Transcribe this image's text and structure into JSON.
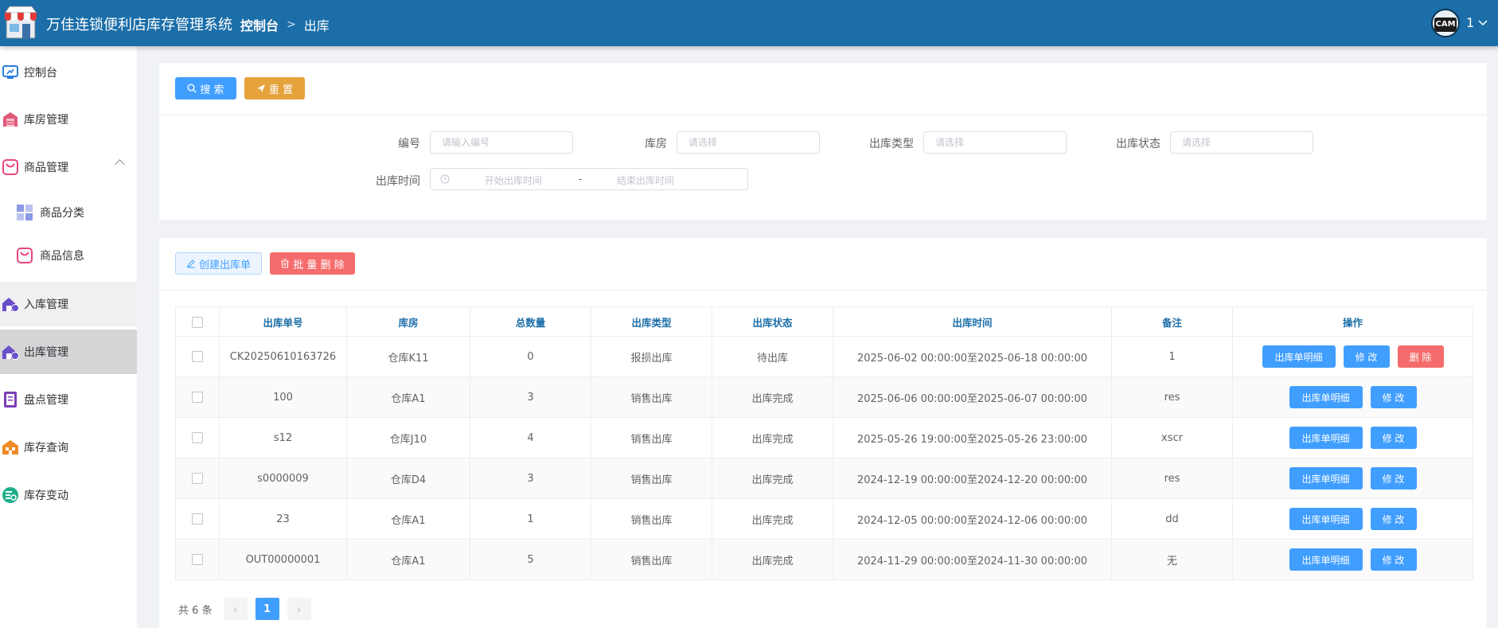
{
  "header": {
    "app_title": "万佳连锁便利店库存管理系统",
    "breadcrumb_home": "控制台",
    "breadcrumb_current": "出库",
    "avatar_text": "CAM",
    "user_name": "1"
  },
  "sidebar": {
    "items": [
      {
        "label": "控制台",
        "icon": "dashboard-icon"
      },
      {
        "label": "库房管理",
        "icon": "warehouse-icon"
      },
      {
        "label": "商品管理",
        "icon": "goods-icon"
      },
      {
        "label": "商品分类",
        "icon": "category-icon"
      },
      {
        "label": "商品信息",
        "icon": "goods-info-icon"
      },
      {
        "label": "入库管理",
        "icon": "inbound-icon"
      },
      {
        "label": "出库管理",
        "icon": "outbound-icon"
      },
      {
        "label": "盘点管理",
        "icon": "inventory-check-icon"
      },
      {
        "label": "库存查询",
        "icon": "stock-query-icon"
      },
      {
        "label": "库存变动",
        "icon": "stock-change-icon"
      }
    ],
    "selected": "出库管理"
  },
  "search": {
    "search_button": "搜 索",
    "reset_button": "重 置",
    "fields": {
      "code": {
        "label": "编号",
        "placeholder": "请输入编号"
      },
      "warehouse": {
        "label": "库房",
        "placeholder": "请选择"
      },
      "type": {
        "label": "出库类型",
        "placeholder": "请选择"
      },
      "status": {
        "label": "出库状态",
        "placeholder": "请选择"
      },
      "time": {
        "label": "出库时间",
        "start_placeholder": "开始出库时间",
        "separator": "-",
        "end_placeholder": "结束出库时间"
      }
    }
  },
  "toolbar": {
    "create_button": "创建出库单",
    "batch_delete_button": "批 量 删 除"
  },
  "table": {
    "headers": [
      "出库单号",
      "库房",
      "总数量",
      "出库类型",
      "出库状态",
      "出库时间",
      "备注",
      "操作"
    ],
    "rows": [
      {
        "code": "CK20250610163726",
        "warehouse": "仓库K11",
        "qty": "0",
        "type": "报损出库",
        "status": "待出库",
        "time": "2025-06-02 00:00:00至2025-06-18 00:00:00",
        "remark": "1",
        "actions": [
          "出库单明细",
          "修 改",
          "删 除"
        ]
      },
      {
        "code": "100",
        "warehouse": "仓库A1",
        "qty": "3",
        "type": "销售出库",
        "status": "出库完成",
        "time": "2025-06-06 00:00:00至2025-06-07 00:00:00",
        "remark": "res",
        "actions": [
          "出库单明细",
          "修 改"
        ]
      },
      {
        "code": "s12",
        "warehouse": "仓库J10",
        "qty": "4",
        "type": "销售出库",
        "status": "出库完成",
        "time": "2025-05-26 19:00:00至2025-05-26 23:00:00",
        "remark": "xscr",
        "actions": [
          "出库单明细",
          "修 改"
        ]
      },
      {
        "code": "s0000009",
        "warehouse": "仓库D4",
        "qty": "3",
        "type": "销售出库",
        "status": "出库完成",
        "time": "2024-12-19 00:00:00至2024-12-20 00:00:00",
        "remark": "res",
        "actions": [
          "出库单明细",
          "修 改"
        ]
      },
      {
        "code": "23",
        "warehouse": "仓库A1",
        "qty": "1",
        "type": "销售出库",
        "status": "出库完成",
        "time": "2024-12-05 00:00:00至2024-12-06 00:00:00",
        "remark": "dd",
        "actions": [
          "出库单明细",
          "修 改"
        ]
      },
      {
        "code": "OUT00000001",
        "warehouse": "仓库A1",
        "qty": "5",
        "type": "销售出库",
        "status": "出库完成",
        "time": "2024-11-29 00:00:00至2024-11-30 00:00:00",
        "remark": "无",
        "actions": [
          "出库单明细",
          "修 改"
        ]
      }
    ]
  },
  "pagination": {
    "total_text": "共 6 条",
    "current_page": "1",
    "prev_icon": "‹",
    "next_icon": "›"
  },
  "colors": {
    "header_bg": "#1b6ea8",
    "primary": "#409eff",
    "warning": "#e6a23c",
    "danger": "#f56c6c"
  }
}
